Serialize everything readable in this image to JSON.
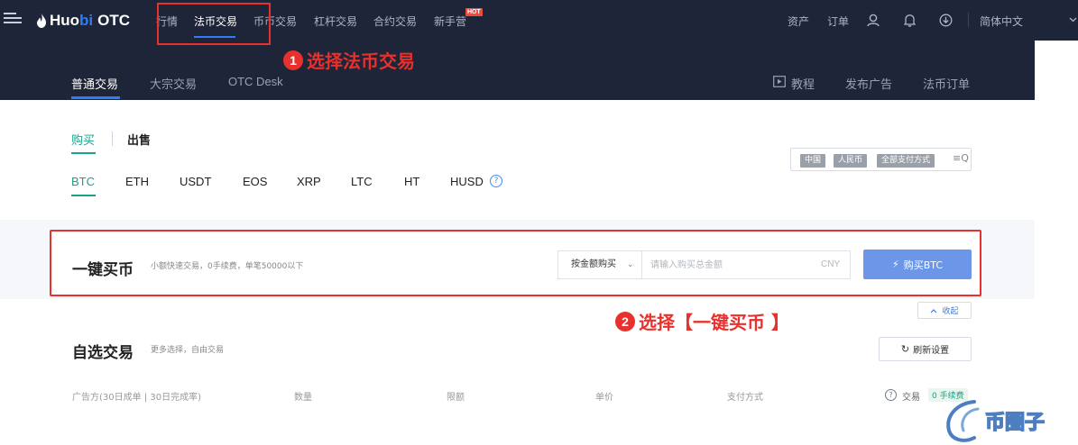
{
  "brand": {
    "logo_main": "Huo",
    "logo_accent": "bi",
    "logo_product": "OTC"
  },
  "topnav": {
    "items": [
      "行情",
      "法币交易",
      "币币交易",
      "杠杆交易",
      "合约交易",
      "新手营"
    ],
    "hot_badge": "HOT",
    "right": {
      "assets": "资产",
      "orders": "订单",
      "language": "简体中文"
    }
  },
  "subnav": {
    "items": [
      "普通交易",
      "大宗交易",
      "OTC Desk"
    ],
    "right": {
      "tutorial": "教程",
      "post_ad": "发布广告",
      "fiat_orders": "法币订单"
    }
  },
  "trade_tabs": {
    "buy": "购买",
    "sell": "出售"
  },
  "coins": [
    "BTC",
    "ETH",
    "USDT",
    "EOS",
    "XRP",
    "LTC",
    "HT",
    "HUSD"
  ],
  "filters": {
    "country": "中国",
    "currency": "人民币",
    "payment": "全部支付方式"
  },
  "quick_buy": {
    "title": "一键买币",
    "subtitle": "小额快速交易，0手续费，单笔50000以下",
    "mode": "按金额购买",
    "placeholder": "请输入购买总金额",
    "unit": "CNY",
    "button": "购买BTC"
  },
  "collapse_label": "收起",
  "custom_trade": {
    "title": "自选交易",
    "subtitle": "更多选择，自由交易",
    "refresh": "刷新设置"
  },
  "table_headers": {
    "advertiser": "广告方(30日成单 | 30日完成率)",
    "quantity": "数量",
    "limit": "限额",
    "price": "单价",
    "payment": "支付方式",
    "action": "交易",
    "fee_badge": "0 手续费"
  },
  "annotations": {
    "step1_num": "1",
    "step1_text": "选择法币交易",
    "step2_num": "2",
    "step2_text": "选择【一键买币 】"
  },
  "watermark": "币圈子",
  "colors": {
    "nav_bg": "#1e2538",
    "accent_blue": "#2f7cf6",
    "accent_green": "#1aa18b",
    "highlight_red": "#e8302d",
    "button_blue": "#6c97e8"
  },
  "icons": [
    "menu-icon",
    "flame-icon",
    "user-icon",
    "bell-icon",
    "download-icon",
    "chevron-down-icon",
    "tutorial-icon",
    "help-icon",
    "filter-icon",
    "bolt-icon",
    "chevron-up-icon",
    "refresh-icon"
  ]
}
